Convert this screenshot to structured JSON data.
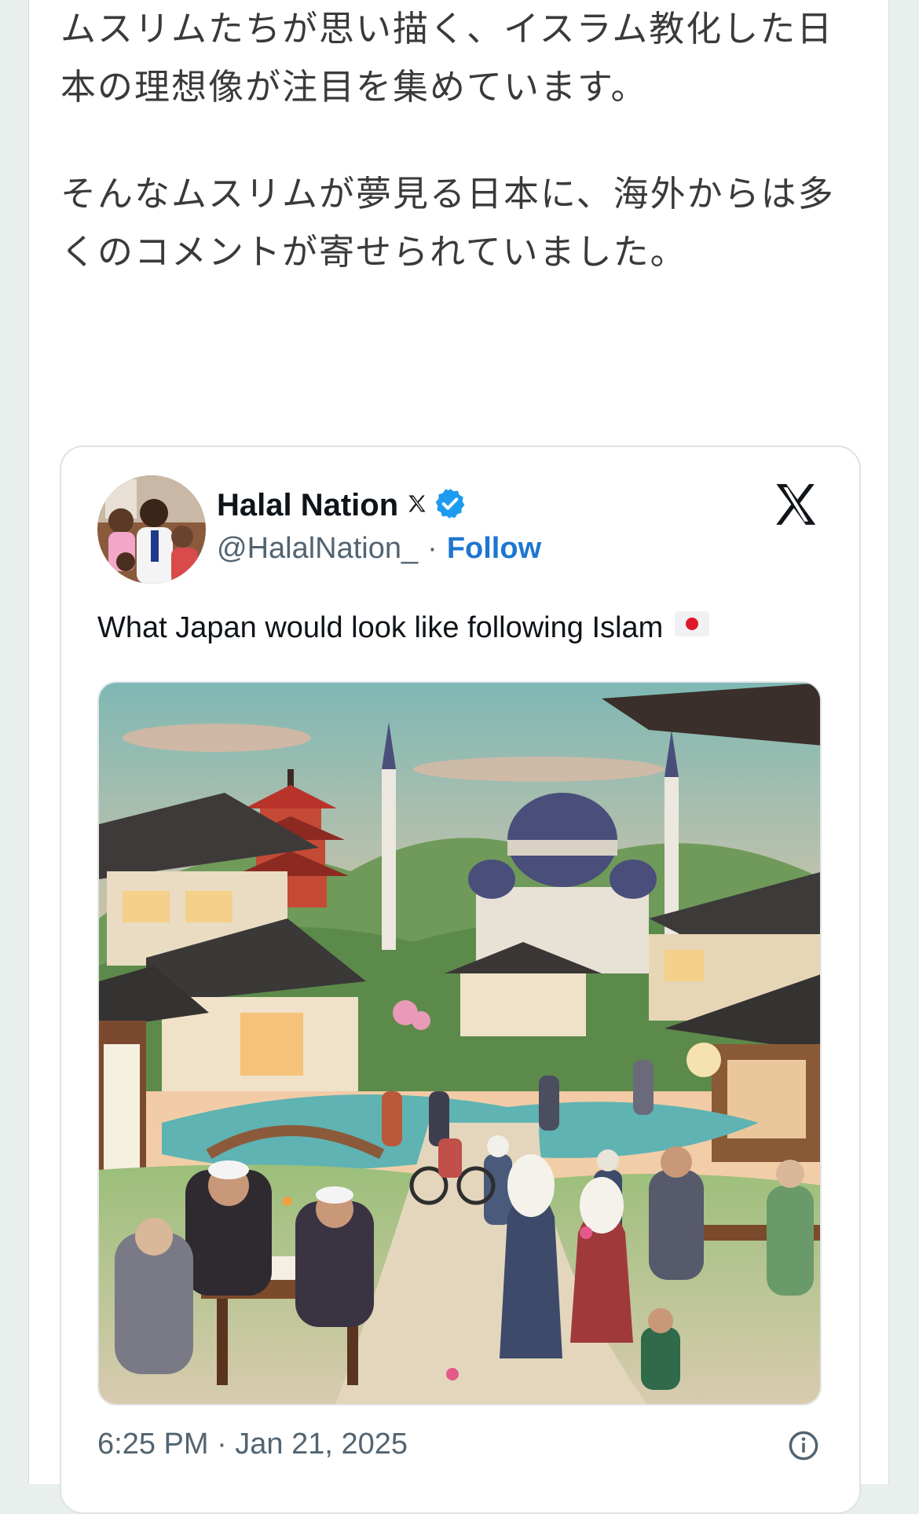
{
  "article": {
    "paragraph1": "ムスリムたちが思い描く、イスラム教化した日本の理想像が注目を集めています。",
    "paragraph2": "そんなムスリムが夢見る日本に、海外からは多くのコメントが寄せられていました。"
  },
  "tweet": {
    "display_name": "Halal Nation",
    "handle": "@HalalNation_",
    "separator": "·",
    "follow_label": "Follow",
    "text": "What Japan would look like following Islam",
    "flag_icon": "japan-flag-icon",
    "timestamp": "6:25 PM · Jan 21, 2025",
    "verified_color": "#1d9bf0",
    "follow_color": "#1d77d1"
  },
  "icons": {
    "x_logo": "x-logo-icon",
    "verified": "verified-badge-icon",
    "info": "info-icon"
  }
}
